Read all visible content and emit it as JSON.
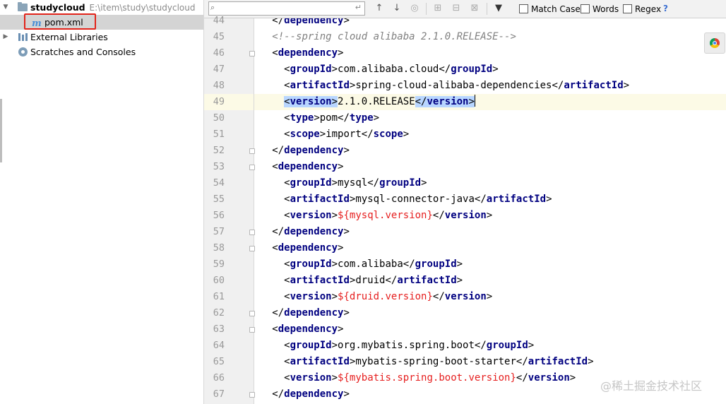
{
  "project_tree": {
    "items": [
      {
        "name": "studycloud",
        "path": "E:\\item\\study\\studycloud",
        "icon": "folder-icon",
        "expanded": true
      },
      {
        "name": "pom.xml",
        "icon": "maven-icon",
        "selected": true
      },
      {
        "name": "External Libraries",
        "icon": "library-icon",
        "expanded": false
      },
      {
        "name": "Scratches and Consoles",
        "icon": "scratches-icon"
      }
    ]
  },
  "toolbar": {
    "search_value": "",
    "match_case_label": "Match Case",
    "words_label": "Words",
    "regex_label": "Regex",
    "help_label": "?"
  },
  "editor": {
    "current_line": 49,
    "lines": [
      {
        "n": "44",
        "fold": false
      },
      {
        "n": "45",
        "fold": false
      },
      {
        "n": "46",
        "fold": true
      },
      {
        "n": "47",
        "fold": false
      },
      {
        "n": "48",
        "fold": false
      },
      {
        "n": "49",
        "fold": false
      },
      {
        "n": "50",
        "fold": false
      },
      {
        "n": "51",
        "fold": false
      },
      {
        "n": "52",
        "fold": true
      },
      {
        "n": "53",
        "fold": true
      },
      {
        "n": "54",
        "fold": false
      },
      {
        "n": "55",
        "fold": false
      },
      {
        "n": "56",
        "fold": false
      },
      {
        "n": "57",
        "fold": true
      },
      {
        "n": "58",
        "fold": true
      },
      {
        "n": "59",
        "fold": false
      },
      {
        "n": "60",
        "fold": false
      },
      {
        "n": "61",
        "fold": false
      },
      {
        "n": "62",
        "fold": true
      },
      {
        "n": "63",
        "fold": true
      },
      {
        "n": "64",
        "fold": false
      },
      {
        "n": "65",
        "fold": false
      },
      {
        "n": "66",
        "fold": false
      },
      {
        "n": "67",
        "fold": true
      }
    ],
    "code": {
      "l44_tag": "dependency",
      "l45_comment": "<!--spring cloud alibaba 2.1.0.RELEASE-->",
      "l46_tag": "dependency",
      "l47_tag": "groupId",
      "l47_text": "com.alibaba.cloud",
      "l48_tag": "artifactId",
      "l48_text": "spring-cloud-alibaba-dependencies",
      "l49_tag": "version",
      "l49_text": "2.1.0.RELEASE",
      "l50_tag": "type",
      "l50_text": "pom",
      "l51_tag": "scope",
      "l51_text": "import",
      "l52_tag": "dependency",
      "l53_tag": "dependency",
      "l54_tag": "groupId",
      "l54_text": "mysql",
      "l55_tag": "artifactId",
      "l55_text": "mysql-connector-java",
      "l56_tag": "version",
      "l56_text": "${mysql.version}",
      "l57_tag": "dependency",
      "l58_tag": "dependency",
      "l59_tag": "groupId",
      "l59_text": "com.alibaba",
      "l60_tag": "artifactId",
      "l60_text": "druid",
      "l61_tag": "version",
      "l61_text": "${druid.version}",
      "l62_tag": "dependency",
      "l63_tag": "dependency",
      "l64_tag": "groupId",
      "l64_text": "org.mybatis.spring.boot",
      "l65_tag": "artifactId",
      "l65_text": "mybatis-spring-boot-starter",
      "l66_tag": "version",
      "l66_text": "${mybatis.spring.boot.version}",
      "l67_tag": "dependency"
    }
  },
  "watermark": "@稀土掘金技术社区",
  "colors": {
    "tag": "#000080",
    "comment": "#808080",
    "property": "#e61f1f",
    "highlight": "#b8d6ff",
    "current_line": "#fcfae6",
    "annotation_box": "#e2231a"
  }
}
